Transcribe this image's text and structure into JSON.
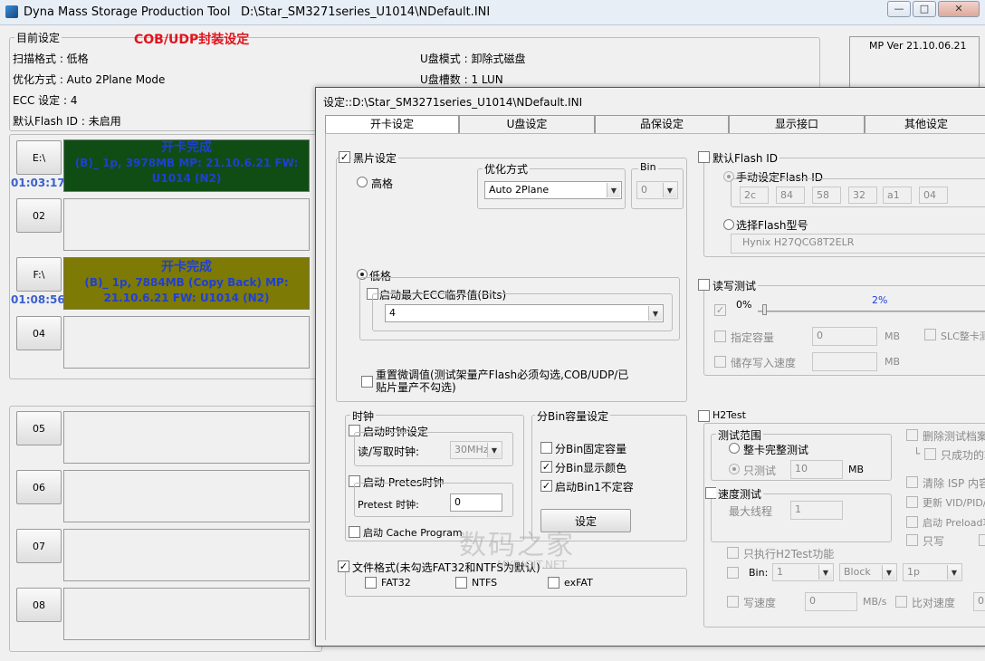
{
  "window": {
    "title": "Dyna Mass Storage Production Tool",
    "path": "D:\\Star_SM3271series_U1014\\NDefault.INI",
    "min": "—",
    "max": "□",
    "close": "✕"
  },
  "main": {
    "current_settings_label": "目前设定",
    "annotation": "COB/UDP封装设定",
    "scan_format": "扫描格式 : 低格",
    "optimize": "优化方式 : Auto 2Plane Mode",
    "ecc": "ECC 设定 : 4",
    "default_flash_id": "默认Flash ID : 未启用",
    "udisk_mode": "U盘模式 : 卸除式磁盘",
    "udisk_slots": "U盘槽数 : 1 LUN",
    "mp_ver": "MP Ver 21.10.06.21"
  },
  "ports": [
    {
      "label": "E:\\",
      "time": "01:03:17",
      "status": "开卡完成",
      "detail": "(B)_ 1p, 3978MB MP: 21.10.6.21 FW: U1014 (N2)",
      "color": "#0f4d14",
      "text_color": "#1f3fd6"
    },
    {
      "label": "02",
      "time": "",
      "status": "",
      "detail": "",
      "color": "",
      "text_color": ""
    },
    {
      "label": "F:\\",
      "time": "01:08:56",
      "status": "开卡完成",
      "detail": "(B)_ 1p, 7884MB (Copy Back) MP: 21.10.6.21 FW: U1014 (N2)",
      "color": "#7d7a05",
      "text_color": "#1f3fd6"
    },
    {
      "label": "04",
      "time": "",
      "status": "",
      "detail": "",
      "color": "",
      "text_color": ""
    },
    {
      "label": "05",
      "time": "",
      "status": "",
      "detail": "",
      "color": "",
      "text_color": ""
    },
    {
      "label": "06",
      "time": "",
      "status": "",
      "detail": "",
      "color": "",
      "text_color": ""
    },
    {
      "label": "07",
      "time": "",
      "status": "",
      "detail": "",
      "color": "",
      "text_color": ""
    },
    {
      "label": "08",
      "time": "",
      "status": "",
      "detail": "",
      "color": "",
      "text_color": ""
    }
  ],
  "dialog": {
    "title": "设定::D:\\Star_SM3271series_U1014\\NDefault.INI",
    "tabs": [
      "开卡设定",
      "U盘设定",
      "品保设定",
      "显示接口",
      "其他设定"
    ],
    "black_settings": "黑片设定",
    "high_format": "高格",
    "optimize_label": "优化方式",
    "optimize_value": "Auto 2Plane",
    "bin_label": "Bin",
    "bin_value": "0",
    "low_format": "低格",
    "ecc_enable": "启动最大ECC临界值(Bits)",
    "ecc_value": "4",
    "reset_tune": "重置微调值(测试架量产Flash必须勾选,COB/UDP/已贴片量产不勾选)",
    "clock": "时钟",
    "clock_enable": "启动时钟设定",
    "rw_clock": "读/写取时钟:",
    "rw_clock_value": "30MHz",
    "pretest_enable": "启动 Pretes时钟",
    "pretest_clock": "Pretest 时钟:",
    "pretest_value": "0",
    "cache_program": "启动 Cache Program",
    "bin_capacity": "分Bin容量设定",
    "bin_fixed": "分Bin固定容量",
    "bin_color": "分Bin显示颜色",
    "bin1_variable": "启动Bin1不定容",
    "set_button": "设定",
    "file_format": "文件格式(未勾选FAT32和NTFS为默认)",
    "fat32": "FAT32",
    "ntfs": "NTFS",
    "exfat": "exFAT",
    "default_flash_id": "默认Flash ID",
    "manual_flash_id": "手动设定Flash ID",
    "flash_id_bytes": [
      "2c",
      "84",
      "58",
      "32",
      "a1",
      "04"
    ],
    "select_flash": "选择Flash型号",
    "flash_model": "Hynix H27QCG8T2ELR",
    "rw_test": "读写测试",
    "progress_zero": "0%",
    "progress_value": "2%",
    "progress_fraction": 0.02,
    "capacity": "指定容量",
    "capacity_value": "0",
    "mb": "MB",
    "slc_full": "SLC整卡测",
    "store_speed": "储存写入速度",
    "h2test": "H2Test",
    "test_range": "测试范围",
    "full_test": "整卡完整测试",
    "partial_test": "只测试",
    "partial_value": "10",
    "speed_test": "速度测试",
    "max_threads": "最大线程",
    "max_threads_value": "1",
    "only_h2test": "只执行H2Test功能",
    "bin_short": "Bin:",
    "bin_sel": "1",
    "block_sel": "Block",
    "p_sel": "1p",
    "write_speed": "写速度",
    "write_speed_value": "0",
    "mbs": "MB/s",
    "compare_speed": "比对速度",
    "compare_value": "0",
    "delete_test": "删除测试档案",
    "only_success": "只成功的软",
    "clear_isp": "清除 ISP 内容",
    "update_vid": "更新 VID/PID/P",
    "preload": "启动 Preload功",
    "readonly": "只写"
  },
  "watermark": {
    "text": "数码之家",
    "sub": "MYDIGIT.NET"
  }
}
